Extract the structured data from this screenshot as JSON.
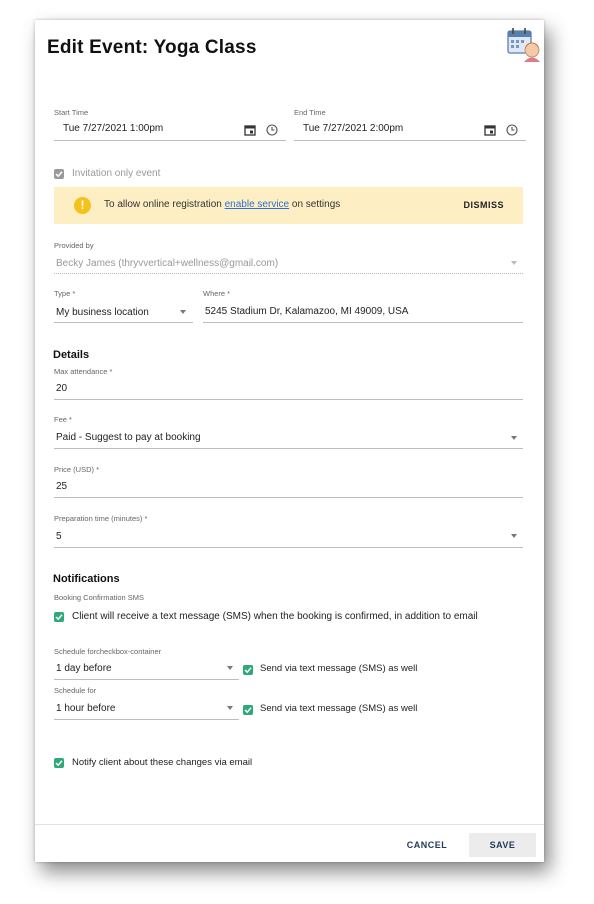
{
  "dialog": {
    "title": "Edit Event: Yoga Class",
    "header_icon": "calendar-person-icon"
  },
  "start_time": {
    "label": "Start Time",
    "value": "Tue 7/27/2021 1:00pm"
  },
  "end_time": {
    "label": "End Time",
    "value": "Tue 7/27/2021 2:00pm"
  },
  "invitation_only": {
    "label": "Invitation only event",
    "checked": true,
    "disabled": true
  },
  "banner": {
    "text_before": "To allow online registration ",
    "link": "enable service",
    "text_after": " on settings",
    "dismiss": "DISMISS",
    "color": "#fdefc3"
  },
  "provided_by": {
    "label": "Provided by",
    "value": "Becky James (thryvvertical+wellness@gmail.com)"
  },
  "type": {
    "label": "Type *",
    "value": "My business location"
  },
  "where": {
    "label": "Where *",
    "value": "5245 Stadium Dr, Kalamazoo, MI 49009, USA"
  },
  "details": {
    "heading": "Details",
    "max_attendance": {
      "label": "Max attendance *",
      "value": "20"
    },
    "fee": {
      "label": "Fee *",
      "value": "Paid - Suggest to pay at booking"
    },
    "price": {
      "label": "Price (USD) *",
      "value": "25"
    },
    "prep_time": {
      "label": "Preparation time (minutes) *",
      "value": "5"
    }
  },
  "notifications": {
    "heading": "Notifications",
    "booking_label": "Booking Confirmation SMS",
    "booking_text": "Client will receive a text message (SMS) when the booking is confirmed, in addition to email",
    "schedule1": {
      "label": "Schedule forcheckbox-container",
      "value": "1 day before",
      "sms_label": "Send via text message (SMS) as well"
    },
    "schedule2": {
      "label": "Schedule for",
      "value": "1 hour before",
      "sms_label": "Send via text message (SMS) as well"
    },
    "notify_text": "Notify client about these changes via email"
  },
  "footer": {
    "cancel": "CANCEL",
    "save": "SAVE"
  },
  "colors": {
    "accent_green": "#2fa87a",
    "button_text": "#1f3b57"
  }
}
